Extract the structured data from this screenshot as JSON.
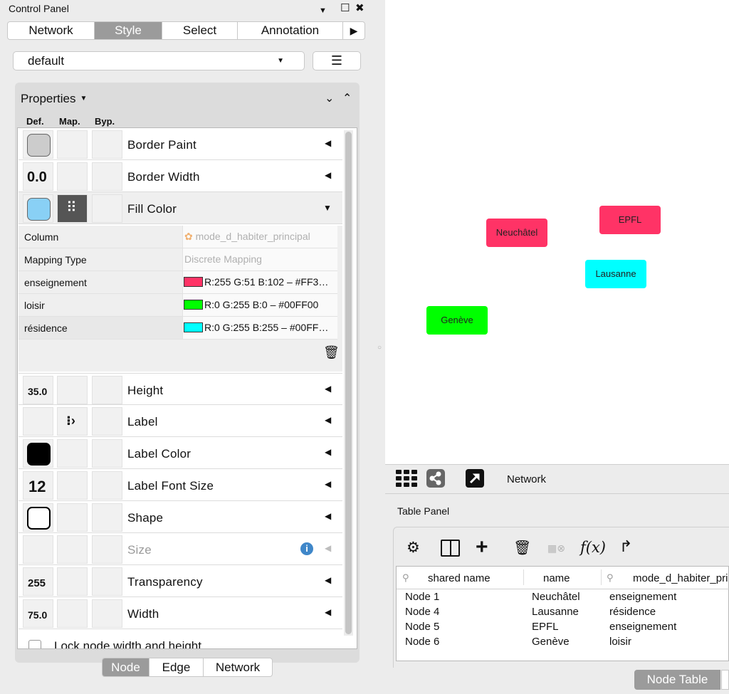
{
  "control_panel": {
    "title": "Control Panel",
    "window_buttons": {
      "menu": "▼",
      "float": "☐",
      "close": "✖"
    },
    "tabs": [
      "Network",
      "Style",
      "Select",
      "Annotation"
    ],
    "active_tab": "Style",
    "more_tabs": "▶",
    "style_select": {
      "value": "default"
    },
    "menu_button": "☰",
    "properties": {
      "title": "Properties",
      "columns": {
        "def": "Def.",
        "map": "Map.",
        "byp": "Byp."
      },
      "rows": [
        {
          "label": "Border Paint"
        },
        {
          "label": "Border Width",
          "def_value": "0.0"
        },
        {
          "label": "Fill Color"
        },
        {
          "label": "Height",
          "def_value": "35.0"
        },
        {
          "label": "Label"
        },
        {
          "label": "Label Color"
        },
        {
          "label": "Label Font Size",
          "def_value": "12"
        },
        {
          "label": "Shape"
        },
        {
          "label": "Size"
        },
        {
          "label": "Transparency",
          "def_value": "255"
        },
        {
          "label": "Width",
          "def_value": "75.0"
        }
      ],
      "fill_mapping": {
        "column_key": "Column",
        "column_value": "mode_d_habiter_principal",
        "type_key": "Mapping Type",
        "type_value": "Discrete Mapping",
        "entries": [
          {
            "key": "enseignement",
            "value": "R:255 G:51 B:102 – #FF3…",
            "color": "#FF3366"
          },
          {
            "key": "loisir",
            "value": "R:0 G:255 B:0 – #00FF00",
            "color": "#00FF00"
          },
          {
            "key": "résidence",
            "value": "R:0 G:255 B:255 – #00FF…",
            "color": "#00FFFF"
          }
        ]
      },
      "lock_label": "Lock node width and height"
    },
    "bottom_tabs": [
      "Node",
      "Edge",
      "Network"
    ],
    "active_bottom_tab": "Node"
  },
  "network": {
    "nodes": [
      {
        "label": "Neuchâtel",
        "color": "#FF3366"
      },
      {
        "label": "EPFL",
        "color": "#FF3366"
      },
      {
        "label": "Lausanne",
        "color": "#00FFFF"
      },
      {
        "label": "Genève",
        "color": "#00FF00"
      }
    ],
    "toolbar_label": "Network"
  },
  "table_panel": {
    "title": "Table Panel",
    "fx_label": "f(x)",
    "columns": [
      "shared name",
      "name",
      "mode_d_habiter_pri"
    ],
    "rows": [
      [
        "Node 1",
        "Neuchâtel",
        "enseignement"
      ],
      [
        "Node 4",
        "Lausanne",
        "résidence"
      ],
      [
        "Node 5",
        "EPFL",
        "enseignement"
      ],
      [
        "Node 6",
        "Genève",
        "loisir"
      ]
    ],
    "active_tab": "Node Table"
  },
  "colors": {
    "border_paint_default": "#CCCCCC",
    "fill_color_default": "#89D0F5",
    "label_color_default": "#000000"
  }
}
